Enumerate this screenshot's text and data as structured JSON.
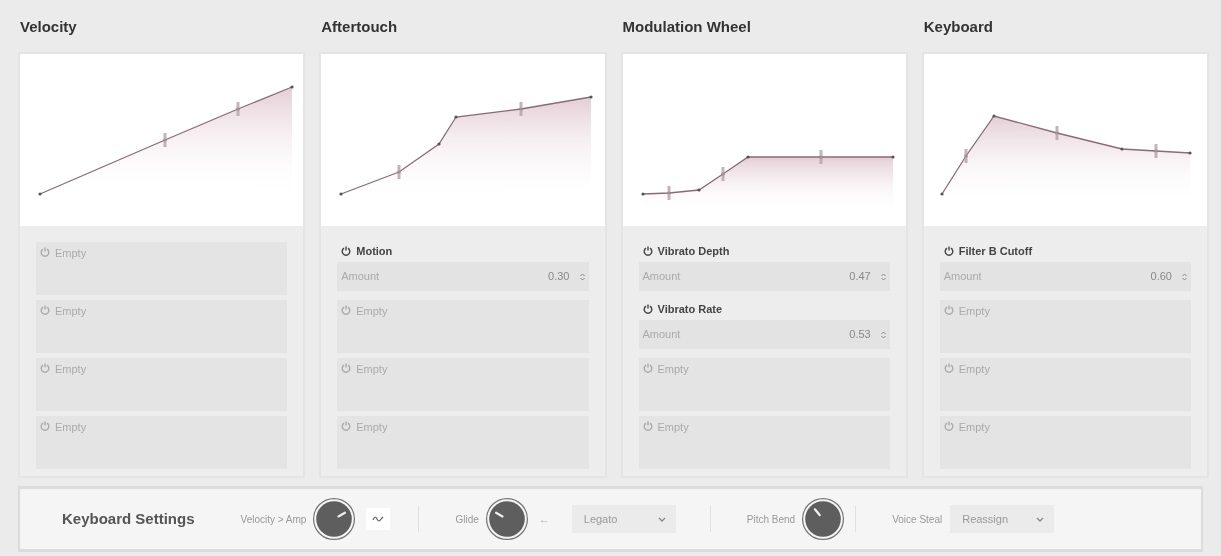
{
  "columns": [
    {
      "title": "Velocity",
      "slots": [
        {
          "kind": "empty",
          "label": "Empty"
        },
        {
          "kind": "empty",
          "label": "Empty"
        },
        {
          "kind": "empty",
          "label": "Empty"
        },
        {
          "kind": "empty",
          "label": "Empty"
        }
      ]
    },
    {
      "title": "Aftertouch",
      "slots": [
        {
          "kind": "assigned",
          "label": "Motion",
          "param": "Amount",
          "value": "0.30"
        },
        {
          "kind": "empty",
          "label": "Empty"
        },
        {
          "kind": "empty",
          "label": "Empty"
        },
        {
          "kind": "empty",
          "label": "Empty"
        }
      ]
    },
    {
      "title": "Modulation Wheel",
      "slots": [
        {
          "kind": "assigned",
          "label": "Vibrato Depth",
          "param": "Amount",
          "value": "0.47"
        },
        {
          "kind": "assigned",
          "label": "Vibrato Rate",
          "param": "Amount",
          "value": "0.53"
        },
        {
          "kind": "empty",
          "label": "Empty"
        },
        {
          "kind": "empty",
          "label": "Empty"
        }
      ]
    },
    {
      "title": "Keyboard",
      "slots": [
        {
          "kind": "assigned",
          "label": "Filter B Cutoff",
          "param": "Amount",
          "value": "0.60"
        },
        {
          "kind": "empty",
          "label": "Empty"
        },
        {
          "kind": "empty",
          "label": "Empty"
        },
        {
          "kind": "empty",
          "label": "Empty"
        }
      ]
    }
  ],
  "settings": {
    "title": "Keyboard Settings",
    "controls": [
      {
        "kind": "knob",
        "label": "Velocity > Amp"
      },
      {
        "kind": "toggle"
      },
      {
        "kind": "divider"
      },
      {
        "kind": "knob",
        "label": "Glide"
      },
      {
        "kind": "glyph",
        "text": "←"
      },
      {
        "kind": "dropdown",
        "value": "Legato"
      },
      {
        "kind": "divider"
      },
      {
        "kind": "knob",
        "label": "Pitch Bend"
      },
      {
        "kind": "divider"
      },
      {
        "kind": "dropdown",
        "label": "Voice Steal",
        "value": "Reassign"
      }
    ]
  }
}
